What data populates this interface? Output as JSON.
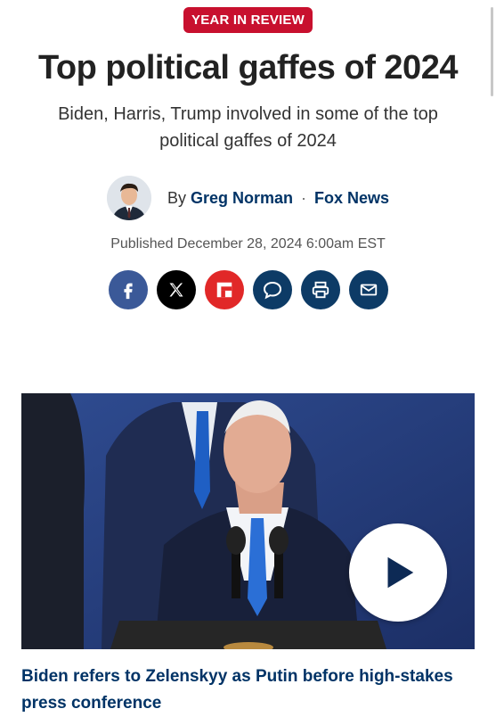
{
  "eyebrow": "YEAR IN REVIEW",
  "headline": "Top political gaffes of 2024",
  "subhead": "Biden, Harris, Trump involved in some of the top political gaffes of 2024",
  "byline": {
    "prefix": "By",
    "author": "Greg Norman",
    "separator": "·",
    "outlet": "Fox News"
  },
  "published": "Published December 28, 2024 6:00am EST",
  "share_icons": [
    "facebook-icon",
    "x-icon",
    "flipboard-icon",
    "comment-icon",
    "print-icon",
    "email-icon"
  ],
  "video": {
    "caption": "Biden refers to Zelenskyy as Putin before high-stakes press conference"
  },
  "colors": {
    "eyebrow_bg": "#c8102e",
    "link_navy": "#003366",
    "facebook": "#3b5998",
    "x": "#000000",
    "flipboard": "#e12828",
    "navy_buttons": "#0d3b66"
  }
}
